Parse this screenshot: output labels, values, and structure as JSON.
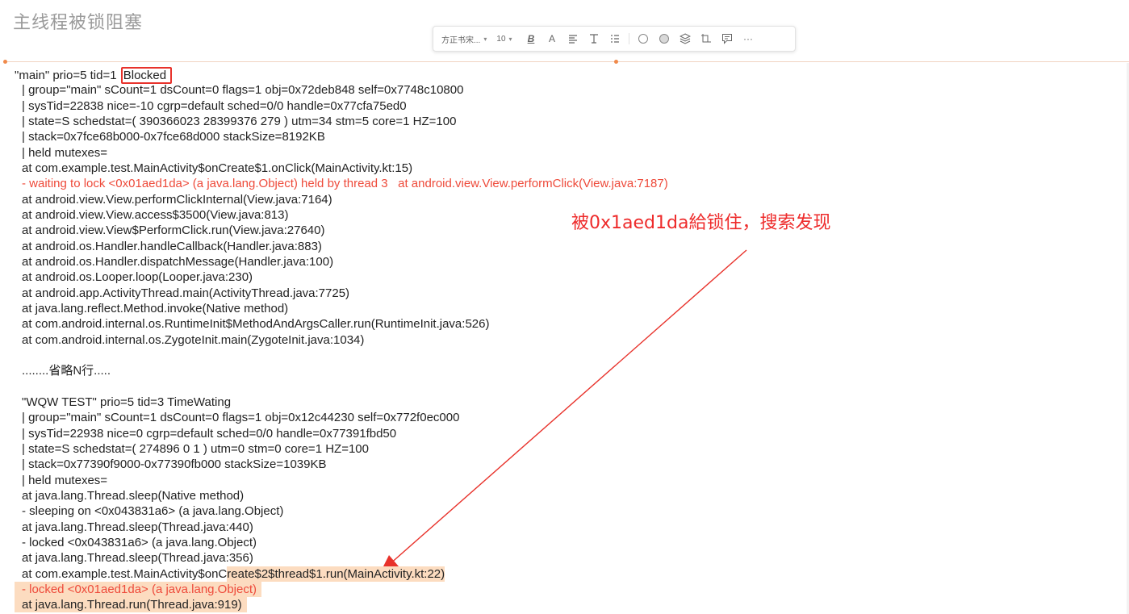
{
  "page": {
    "title": "主线程被锁阻塞"
  },
  "toolbar": {
    "font_name": "方正书宋...",
    "font_size": "10",
    "bold": "B",
    "font_color": "A",
    "more": "···"
  },
  "log": {
    "main_header_prefix": "\"main\" prio=5 tid=1 ",
    "main_state": "Blocked",
    "main_lines": [
      "| group=\"main\" sCount=1 dsCount=0 flags=1 obj=0x72deb848 self=0x7748c10800",
      "| sysTid=22838 nice=-10 cgrp=default sched=0/0 handle=0x77cfa75ed0",
      "| state=S schedstat=( 390366023 28399376 279 ) utm=34 stm=5 core=1 HZ=100",
      "| stack=0x7fce68b000-0x7fce68d000 stackSize=8192KB",
      "| held mutexes=",
      "at com.example.test.MainActivity$onCreate$1.onClick(MainActivity.kt:15)"
    ],
    "waiting_line": "- waiting to lock <0x01aed1da> (a java.lang.Object) held by thread 3   at android.view.View.performClick(View.java:7187)",
    "main_stack": [
      "at android.view.View.performClickInternal(View.java:7164)",
      "at android.view.View.access$3500(View.java:813)",
      "at android.view.View$PerformClick.run(View.java:27640)",
      "at android.os.Handler.handleCallback(Handler.java:883)",
      "at android.os.Handler.dispatchMessage(Handler.java:100)",
      "at android.os.Looper.loop(Looper.java:230)",
      "at android.app.ActivityThread.main(ActivityThread.java:7725)",
      "at java.lang.reflect.Method.invoke(Native method)",
      "at com.android.internal.os.RuntimeInit$MethodAndArgsCaller.run(RuntimeInit.java:526)",
      "at com.android.internal.os.ZygoteInit.main(ZygoteInit.java:1034)"
    ],
    "omitted": "........省略N行.....",
    "wqw_header": "\"WQW TEST\" prio=5 tid=3 TimeWating",
    "wqw_lines": [
      "| group=\"main\" sCount=1 dsCount=0 flags=1 obj=0x12c44230 self=0x772f0ec000",
      "| sysTid=22938 nice=0 cgrp=default sched=0/0 handle=0x77391fbd50",
      "| state=S schedstat=( 274896 0 1 ) utm=0 stm=0 core=1 HZ=100",
      "| stack=0x77390f9000-0x77390fb000 stackSize=1039KB",
      "| held mutexes=",
      "at java.lang.Thread.sleep(Native method)",
      "- sleeping on <0x043831a6> (a java.lang.Object)",
      "at java.lang.Thread.sleep(Thread.java:440)",
      "- locked <0x043831a6> (a java.lang.Object)",
      "at java.lang.Thread.sleep(Thread.java:356)"
    ],
    "run_line_a": "at com.example.test.MainActivity$onC",
    "run_line_b": "reate$2$thread$1.run(MainActivity.kt:22)",
    "locked_line": "- locked <0x01aed1da> (a java.lang.Object)",
    "last_line": "at java.lang.Thread.run(Thread.java:919)"
  },
  "annotation": {
    "text": "被0x1aed1da給锁住，搜索发现"
  },
  "colors": {
    "annotation_red": "#ee2b2b",
    "log_red": "#ee4a3a",
    "highlight": "#fcdcc0",
    "box_red": "#e8322b"
  }
}
